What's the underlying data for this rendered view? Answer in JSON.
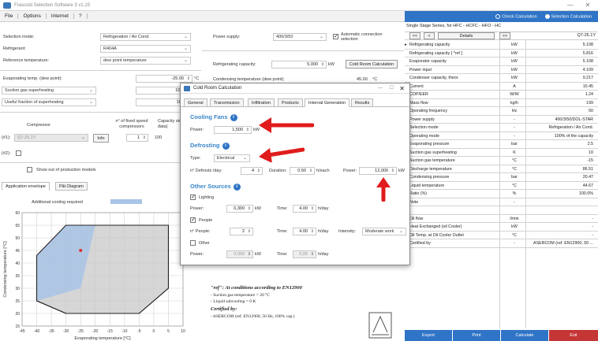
{
  "window": {
    "title": "Frascold Selection Software 3 v1.15",
    "min": "—",
    "close": "✕"
  },
  "menu": [
    "File",
    "Options",
    "Internet",
    "?"
  ],
  "calc_mode": {
    "check": "Check Calculation",
    "selection": "Selection Calculation"
  },
  "left": {
    "selection_mode_label": "Selection mode:",
    "selection_mode": "Refrigeration / Air Cond.",
    "refrigerant_label": "Refrigerant:",
    "refrigerant": "R404A",
    "ref_temp_label": "Reference temperature:",
    "ref_temp": "dew point temperature",
    "evap_label": "Evaporating temp. (dew point):",
    "evap_value": "-25.00",
    "evap_unit": "°C",
    "suction_label": "Suction gas superheating",
    "suction_value": "10.0",
    "useful_label": "Useful fraction of superheating",
    "useful_value": "100",
    "compressor_label": "Compressor",
    "nfixed_label": "n° of fixed speed compressors",
    "capacity_label": "Capacity step (font data)",
    "row1_label": "(#1):",
    "row1_model": "Q7-25.1Y",
    "info_btn": "Info",
    "row1_n": "1",
    "row1_cap": "100",
    "row2_label": "(#2):",
    "show_out_label": "Show out of production models",
    "tab_app": "Application envelope",
    "tab_ph": "P&i Diagram",
    "legend_label": "Additional cooling required"
  },
  "mid": {
    "power_supply_label": "Power supply:",
    "power_supply": "400/3/50",
    "auto_conn": "Automatic connection selection",
    "ref_cap_label": "Refrigerating capacity:",
    "ref_cap_value": "5,000",
    "ref_cap_unit": "kW",
    "cold_room_btn": "Cold Room Calculation",
    "cond_label": "Condensing temperature (dew point):",
    "cond_value": "45.00",
    "cond_unit": "°C"
  },
  "dialog": {
    "title": "Cold Room Calculation",
    "tabs": [
      "General",
      "Transmission",
      "Infiltration",
      "Products",
      "Internal Generation",
      "Results"
    ],
    "cooling_fans_title": "Cooling Fans",
    "power_label": "Power:",
    "fans_power": "1,500",
    "kw": "kW",
    "defrosting_title": "Defrosting",
    "type_label": "Type:",
    "type_value": "Electrical",
    "defrosts_label": "n° Defrosts /day:",
    "defrosts_value": "4",
    "duration_label": "Duration:",
    "duration_value": "0.50",
    "duration_unit": "h/each",
    "def_power_label": "Power:",
    "def_power_value": "12,000",
    "def_power_unit": "kW",
    "other_title": "Other Sources",
    "lighting_label": "Lighting",
    "light_power": "0,300",
    "time_label": "Time:",
    "light_time": "4.00",
    "hday": "h/day",
    "people_label": "People",
    "npeople_label": "n° People:",
    "npeople": "2",
    "people_time": "4.00",
    "intensity_label": "Intensity:",
    "intensity": "Moderate work",
    "other_label": "Other",
    "other_power": "0,000",
    "other_time": "0,00"
  },
  "notes": {
    "line1": "\"ref\": At conditions according to EN12900",
    "line2": "- Suction gas temperature = 20 °C",
    "line3": "- Liquid subcooling = 0 K",
    "line4": "Certified by:",
    "line5": "- ASERCOM (ref. EN12900, 50 Hz, 100% cap.)"
  },
  "results": {
    "header": "Single Stage Series, for HFC - HCFC - HFO - HC",
    "nav_prev2": "<<",
    "nav_prev": "<",
    "details": "Details",
    "nav_next": ">>",
    "rows": [
      {
        "name": "Refrigerating capacity",
        "unit": "kW",
        "value": "5.108"
      },
      {
        "name": "Refrigerating capacity [ *ref ]",
        "unit": "kW",
        "value": "5.816"
      },
      {
        "name": "Evaporator capacity",
        "unit": "kW",
        "value": "5.108"
      },
      {
        "name": "Power input",
        "unit": "kW",
        "value": "4.109"
      },
      {
        "name": "Condenser capacity, theor.",
        "unit": "kW",
        "value": "9.217"
      },
      {
        "name": "Current",
        "unit": "A",
        "value": "10.45"
      },
      {
        "name": "COP/EER",
        "unit": "W/W",
        "value": "1.24"
      },
      {
        "name": "Mass flow",
        "unit": "kg/h",
        "value": "199"
      },
      {
        "name": "Operating frequency",
        "unit": "Hz",
        "value": "50"
      },
      {
        "name": "Power supply",
        "unit": "-",
        "value": "400/3/50/DOL-STAR"
      },
      {
        "name": "Selection mode",
        "unit": "-",
        "value": "Refrigeration / Air Cond."
      },
      {
        "name": "Operating mode",
        "unit": "-",
        "value": "100% of the capacity"
      },
      {
        "name": "Evaporating pressure",
        "unit": "bar",
        "value": "2.5"
      },
      {
        "name": "Suction gas superheating",
        "unit": "K",
        "value": "10"
      },
      {
        "name": "Suction gas temperature",
        "unit": "°C",
        "value": "-15"
      },
      {
        "name": "Discharge temperature",
        "unit": "°C",
        "value": "86.51"
      },
      {
        "name": "Condensing pressure",
        "unit": "bar",
        "value": "20.47"
      },
      {
        "name": "Liquid temperature",
        "unit": "°C",
        "value": "44.67"
      },
      {
        "name": "Ratio (%)",
        "unit": "%",
        "value": "100.0%"
      },
      {
        "name": "Note",
        "unit": "-",
        "value": ""
      },
      {
        "name": "",
        "unit": "",
        "value": ""
      },
      {
        "name": "Oil flow",
        "unit": "l/min",
        "value": "-"
      },
      {
        "name": "Heat Exchanged (oil Cooler)",
        "unit": "kW",
        "value": "-"
      },
      {
        "name": "Oil Temp. at Oil Cooler Outlet",
        "unit": "°C",
        "value": "-"
      },
      {
        "name": "Certified by",
        "unit": "-",
        "value": "ASERCOM (ref. EN12900, 50 ..."
      }
    ],
    "title_value": "Q7-25.1Y",
    "buttons": {
      "export": "Export",
      "print": "Print",
      "calculate": "Calculate",
      "exit": "Exit"
    }
  },
  "chart_data": {
    "type": "area",
    "xlabel": "Evaporating temperature [°C]",
    "ylabel": "Condensing temperature [°C]",
    "xlim": [
      -45,
      10
    ],
    "ylim": [
      15,
      60
    ],
    "xticks": [
      -45,
      -40,
      -35,
      -30,
      -25,
      -20,
      -15,
      -10,
      -5,
      0,
      5,
      10
    ],
    "yticks": [
      15,
      20,
      25,
      30,
      35,
      40,
      45,
      50,
      55,
      60
    ],
    "envelope": [
      [
        -40,
        25
      ],
      [
        -40,
        43
      ],
      [
        -30,
        55
      ],
      [
        5,
        55
      ],
      [
        5,
        30
      ],
      [
        -5,
        20
      ],
      [
        -30,
        20
      ]
    ],
    "additional_cooling": [
      [
        -40,
        43
      ],
      [
        -30,
        55
      ],
      [
        -20,
        55
      ],
      [
        -25,
        30
      ],
      [
        -40,
        25
      ]
    ],
    "operating_point": [
      -25,
      45
    ],
    "legend": "Additional cooling required",
    "colors": {
      "envelope": "#c8c8c8",
      "cooling": "#a9c4e6",
      "point": "#e03030"
    }
  }
}
